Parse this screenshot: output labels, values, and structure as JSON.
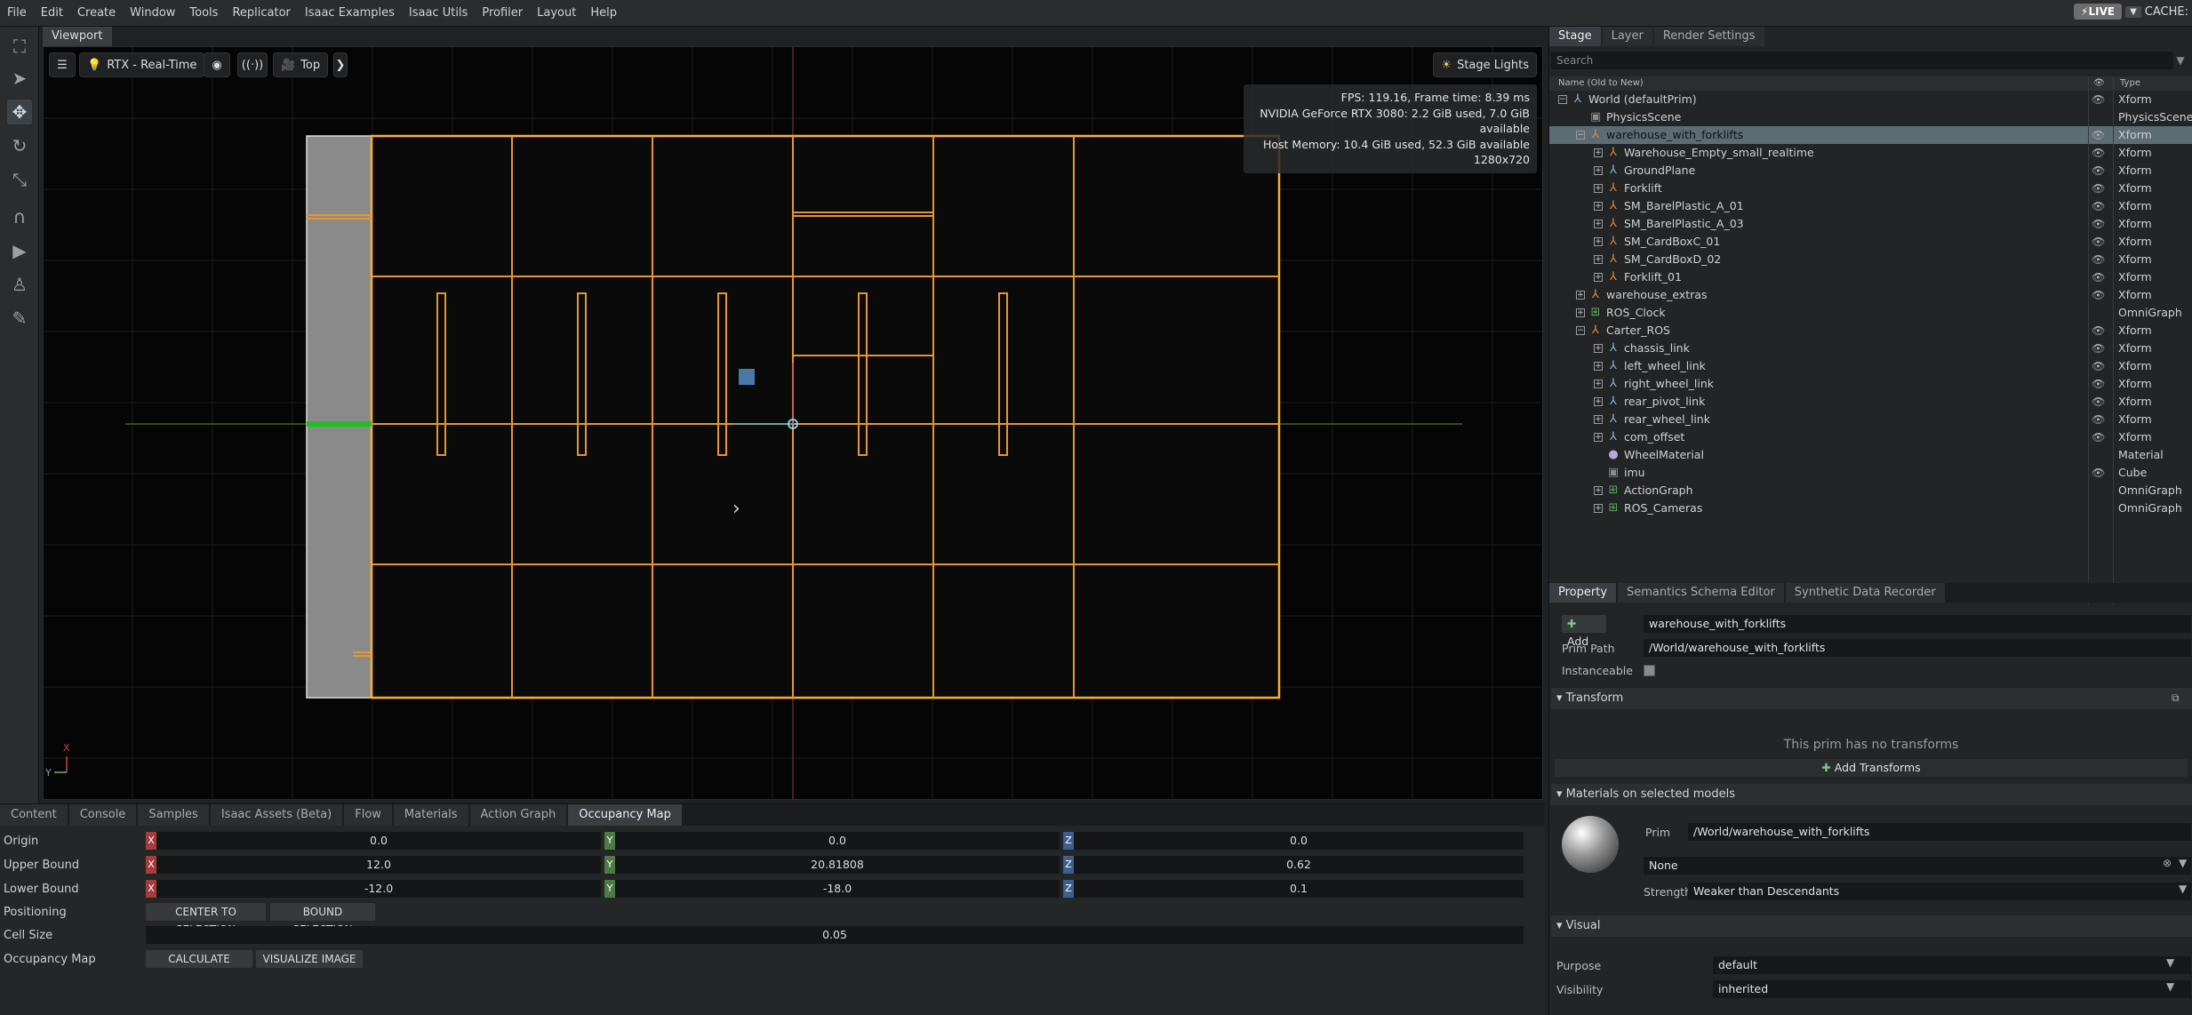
{
  "menubar": {
    "items": [
      "File",
      "Edit",
      "Create",
      "Window",
      "Tools",
      "Replicator",
      "Isaac Examples",
      "Isaac Utils",
      "Profiler",
      "Layout",
      "Help"
    ],
    "live": "LIVE",
    "cache": "CACHE:"
  },
  "viewport": {
    "tab": "Viewport",
    "renderer": "RTX - Real-Time",
    "camera": "Top",
    "stage_lights": "Stage Lights",
    "stats": [
      "FPS: 119.16, Frame time: 8.39 ms",
      "NVIDIA GeForce RTX 3080: 2.2 GiB used, 7.0 GiB available",
      "Host Memory: 10.4 GiB used, 52.3 GiB available",
      "1280x720"
    ],
    "axis_x": "X",
    "axis_y": "Y"
  },
  "bottom_tabs": [
    "Content",
    "Console",
    "Samples",
    "Isaac Assets (Beta)",
    "Flow",
    "Materials",
    "Action Graph",
    "Occupancy Map"
  ],
  "occupancy": {
    "origin_label": "Origin",
    "origin": [
      "0.0",
      "0.0",
      "0.0"
    ],
    "upper_label": "Upper Bound",
    "upper": [
      "12.0",
      "20.81808",
      "0.62"
    ],
    "lower_label": "Lower Bound",
    "lower": [
      "-12.0",
      "-18.0",
      "0.1"
    ],
    "positioning_label": "Positioning",
    "center_btn": "CENTER TO SELECTION",
    "bound_btn": "BOUND SELECTION",
    "cell_label": "Cell Size",
    "cell": "0.05",
    "map_label": "Occupancy Map",
    "calc_btn": "CALCULATE",
    "vis_btn": "VISUALIZE IMAGE"
  },
  "stage": {
    "tabs": [
      "Stage",
      "Layer",
      "Render Settings"
    ],
    "search_placeholder": "Search",
    "col_name": "Name (Old to New)",
    "col_type": "Type",
    "rows": [
      {
        "name": "World (defaultPrim)",
        "type": "Xform",
        "depth": 0,
        "exp": "−",
        "icon": "xform",
        "eye": true
      },
      {
        "name": "PhysicsScene",
        "type": "PhysicsScene",
        "depth": 1,
        "exp": "",
        "icon": "cube",
        "eye": false
      },
      {
        "name": "warehouse_with_forklifts",
        "type": "Xform",
        "depth": 1,
        "exp": "−",
        "icon": "ref",
        "eye": true,
        "sel": true
      },
      {
        "name": "Warehouse_Empty_small_realtime",
        "type": "Xform",
        "depth": 2,
        "exp": "+",
        "icon": "ref",
        "eye": true
      },
      {
        "name": "GroundPlane",
        "type": "Xform",
        "depth": 2,
        "exp": "+",
        "icon": "xform",
        "eye": true
      },
      {
        "name": "Forklift",
        "type": "Xform",
        "depth": 2,
        "exp": "+",
        "icon": "ref",
        "eye": true
      },
      {
        "name": "SM_BarelPlastic_A_01",
        "type": "Xform",
        "depth": 2,
        "exp": "+",
        "icon": "ref",
        "eye": true
      },
      {
        "name": "SM_BarelPlastic_A_03",
        "type": "Xform",
        "depth": 2,
        "exp": "+",
        "icon": "ref",
        "eye": true
      },
      {
        "name": "SM_CardBoxC_01",
        "type": "Xform",
        "depth": 2,
        "exp": "+",
        "icon": "ref",
        "eye": true
      },
      {
        "name": "SM_CardBoxD_02",
        "type": "Xform",
        "depth": 2,
        "exp": "+",
        "icon": "ref",
        "eye": true
      },
      {
        "name": "Forklift_01",
        "type": "Xform",
        "depth": 2,
        "exp": "+",
        "icon": "ref",
        "eye": true
      },
      {
        "name": "warehouse_extras",
        "type": "Xform",
        "depth": 1,
        "exp": "+",
        "icon": "ref",
        "eye": true
      },
      {
        "name": "ROS_Clock",
        "type": "OmniGraph",
        "depth": 1,
        "exp": "+",
        "icon": "graph",
        "eye": false
      },
      {
        "name": "Carter_ROS",
        "type": "Xform",
        "depth": 1,
        "exp": "−",
        "icon": "ref",
        "eye": true
      },
      {
        "name": "chassis_link",
        "type": "Xform",
        "depth": 2,
        "exp": "+",
        "icon": "xform",
        "eye": true
      },
      {
        "name": "left_wheel_link",
        "type": "Xform",
        "depth": 2,
        "exp": "+",
        "icon": "xform",
        "eye": true
      },
      {
        "name": "right_wheel_link",
        "type": "Xform",
        "depth": 2,
        "exp": "+",
        "icon": "xform",
        "eye": true
      },
      {
        "name": "rear_pivot_link",
        "type": "Xform",
        "depth": 2,
        "exp": "+",
        "icon": "xform",
        "eye": true
      },
      {
        "name": "rear_wheel_link",
        "type": "Xform",
        "depth": 2,
        "exp": "+",
        "icon": "xform",
        "eye": true
      },
      {
        "name": "com_offset",
        "type": "Xform",
        "depth": 2,
        "exp": "+",
        "icon": "xform",
        "eye": true
      },
      {
        "name": "WheelMaterial",
        "type": "Material",
        "depth": 2,
        "exp": "",
        "icon": "material",
        "eye": false
      },
      {
        "name": "imu",
        "type": "Cube",
        "depth": 2,
        "exp": "",
        "icon": "cube",
        "eye": true
      },
      {
        "name": "ActionGraph",
        "type": "OmniGraph",
        "depth": 2,
        "exp": "+",
        "icon": "graph",
        "eye": false
      },
      {
        "name": "ROS_Cameras",
        "type": "OmniGraph",
        "depth": 2,
        "exp": "+",
        "icon": "graph",
        "eye": false
      }
    ]
  },
  "property": {
    "tabs": [
      "Property",
      "Semantics Schema Editor",
      "Synthetic Data Recorder"
    ],
    "add_btn": "Add",
    "name_value": "warehouse_with_forklifts",
    "prim_path_label": "Prim Path",
    "prim_path": "/World/warehouse_with_forklifts",
    "instanceable_label": "Instanceable",
    "transform_section": "Transform",
    "no_transforms": "This prim has no transforms",
    "add_transforms": "Add Transforms",
    "materials_section": "Materials on selected models",
    "prim_label": "Prim",
    "prim_value": "/World/warehouse_with_forklifts",
    "material_value": "None",
    "strength_label": "Strength",
    "strength_value": "Weaker than Descendants",
    "visual_section": "Visual",
    "purpose_label": "Purpose",
    "purpose_value": "default",
    "visibility_label": "Visibility",
    "visibility_value": "inherited"
  }
}
